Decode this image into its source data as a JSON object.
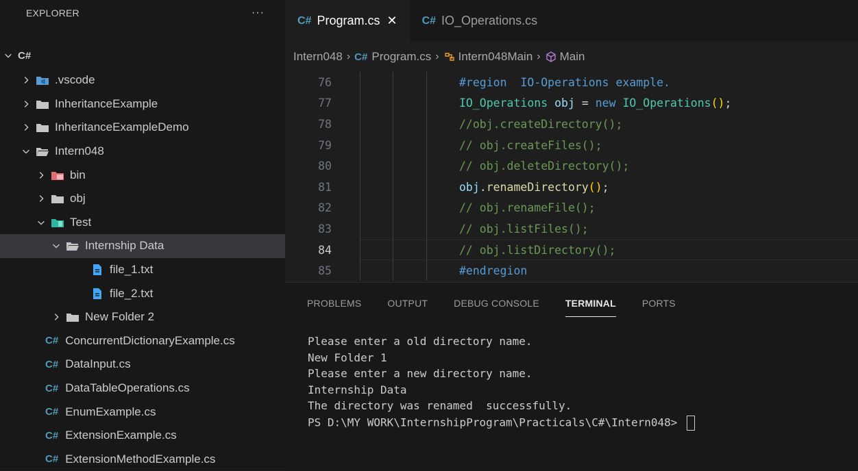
{
  "explorer": {
    "title": "EXPLORER",
    "more": "···",
    "root": "C#",
    "items": [
      {
        "label": ".vscode",
        "indent": 0,
        "chevron": "right",
        "icon": "vscode-folder-icon"
      },
      {
        "label": "InheritanceExample",
        "indent": 0,
        "chevron": "right",
        "icon": "folder-icon"
      },
      {
        "label": "InheritanceExampleDemo",
        "indent": 0,
        "chevron": "right",
        "icon": "folder-icon"
      },
      {
        "label": "Intern048",
        "indent": 0,
        "chevron": "down",
        "icon": "folder-open-icon"
      },
      {
        "label": "bin",
        "indent": 1,
        "chevron": "right",
        "icon": "bin-folder-icon"
      },
      {
        "label": "obj",
        "indent": 1,
        "chevron": "right",
        "icon": "folder-icon"
      },
      {
        "label": "Test",
        "indent": 1,
        "chevron": "down",
        "icon": "test-folder-icon"
      },
      {
        "label": "Internship Data",
        "indent": 2,
        "chevron": "down",
        "icon": "folder-open-icon",
        "selected": true
      },
      {
        "label": "file_1.txt",
        "indent": 3,
        "chevron": "none",
        "icon": "text-file-icon"
      },
      {
        "label": "file_2.txt",
        "indent": 3,
        "chevron": "none",
        "icon": "text-file-icon"
      },
      {
        "label": "New Folder 2",
        "indent": 2,
        "chevron": "right",
        "icon": "folder-icon"
      },
      {
        "label": "ConcurrentDictionaryExample.cs",
        "indent": 1,
        "chevron": "none",
        "icon": "csharp-file-icon"
      },
      {
        "label": "DataInput.cs",
        "indent": 1,
        "chevron": "none",
        "icon": "csharp-file-icon"
      },
      {
        "label": "DataTableOperations.cs",
        "indent": 1,
        "chevron": "none",
        "icon": "csharp-file-icon"
      },
      {
        "label": "EnumExample.cs",
        "indent": 1,
        "chevron": "none",
        "icon": "csharp-file-icon"
      },
      {
        "label": "ExtensionExample.cs",
        "indent": 1,
        "chevron": "none",
        "icon": "csharp-file-icon"
      },
      {
        "label": "ExtensionMethodExample.cs",
        "indent": 1,
        "chevron": "none",
        "icon": "csharp-file-icon"
      }
    ]
  },
  "tabs": [
    {
      "badge": "C#",
      "label": "Program.cs",
      "active": true,
      "close": "✕"
    },
    {
      "badge": "C#",
      "label": "IO_Operations.cs",
      "active": false
    }
  ],
  "breadcrumb": {
    "folder": "Intern048",
    "badge": "C#",
    "file": "Program.cs",
    "class_name": "Intern048Main",
    "method": "Main",
    "separator": "›"
  },
  "code": {
    "current_line": "84",
    "lines": [
      {
        "num": "76",
        "parts": [
          {
            "t": "#region  IO-Operations example.",
            "c": "c-kw"
          }
        ]
      },
      {
        "num": "77",
        "parts": [
          {
            "t": "IO_Operations",
            "c": "c-type"
          },
          {
            "t": " ",
            "c": "c-plain"
          },
          {
            "t": "obj",
            "c": "c-var"
          },
          {
            "t": " = ",
            "c": "c-plain"
          },
          {
            "t": "new",
            "c": "c-kw"
          },
          {
            "t": " ",
            "c": "c-plain"
          },
          {
            "t": "IO_Operations",
            "c": "c-type"
          },
          {
            "t": "()",
            "c": "c-paren"
          },
          {
            "t": ";",
            "c": "c-plain"
          }
        ]
      },
      {
        "num": "78",
        "parts": [
          {
            "t": "//obj.createDirectory();",
            "c": "c-comment"
          }
        ]
      },
      {
        "num": "79",
        "parts": [
          {
            "t": "// obj.createFiles();",
            "c": "c-comment"
          }
        ]
      },
      {
        "num": "80",
        "parts": [
          {
            "t": "// obj.deleteDirectory();",
            "c": "c-comment"
          }
        ]
      },
      {
        "num": "81",
        "parts": [
          {
            "t": "obj",
            "c": "c-var"
          },
          {
            "t": ".",
            "c": "c-plain"
          },
          {
            "t": "renameDirectory",
            "c": "c-fn"
          },
          {
            "t": "()",
            "c": "c-paren"
          },
          {
            "t": ";",
            "c": "c-plain"
          }
        ]
      },
      {
        "num": "82",
        "parts": [
          {
            "t": "// obj.renameFile();",
            "c": "c-comment"
          }
        ]
      },
      {
        "num": "83",
        "parts": [
          {
            "t": "// obj.listFiles();",
            "c": "c-comment"
          }
        ]
      },
      {
        "num": "84",
        "parts": [
          {
            "t": "// obj.listDirectory();",
            "c": "c-comment"
          }
        ]
      },
      {
        "num": "85",
        "parts": [
          {
            "t": "#endregion",
            "c": "c-kw"
          }
        ]
      }
    ]
  },
  "panel": {
    "tabs": [
      {
        "label": "PROBLEMS",
        "active": false
      },
      {
        "label": "OUTPUT",
        "active": false
      },
      {
        "label": "DEBUG CONSOLE",
        "active": false
      },
      {
        "label": "TERMINAL",
        "active": true
      },
      {
        "label": "PORTS",
        "active": false
      }
    ],
    "terminal_lines": [
      "Please enter a old directory name.",
      "New Folder 1",
      "Please enter a new directory name.",
      "Internship Data",
      "The directory was renamed  successfully.",
      "PS D:\\MY WORK\\InternshipProgram\\Practicals\\C#\\Intern048> "
    ]
  },
  "colors": {
    "sidebar_bg": "#181818",
    "editor_bg": "#1e1e1e",
    "selected_bg": "#37373d",
    "csharp_badge": "#519aba",
    "keyword": "#569cd6",
    "comment": "#6a9955",
    "type": "#4ec9b0"
  }
}
